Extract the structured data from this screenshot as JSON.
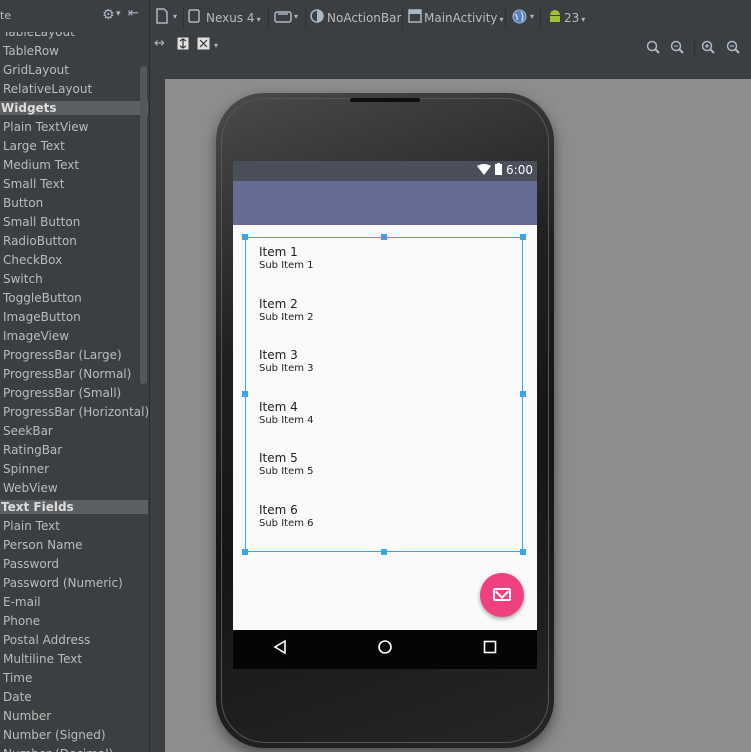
{
  "palette": {
    "header_title": "te",
    "items": [
      {
        "kind": "item",
        "label": "TableLayout"
      },
      {
        "kind": "item",
        "label": "TableRow"
      },
      {
        "kind": "item",
        "label": "GridLayout"
      },
      {
        "kind": "item",
        "label": "RelativeLayout"
      },
      {
        "kind": "category",
        "label": "Widgets"
      },
      {
        "kind": "item",
        "label": "Plain TextView"
      },
      {
        "kind": "item",
        "label": "Large Text"
      },
      {
        "kind": "item",
        "label": "Medium Text"
      },
      {
        "kind": "item",
        "label": "Small Text"
      },
      {
        "kind": "item",
        "label": "Button"
      },
      {
        "kind": "item",
        "label": "Small Button"
      },
      {
        "kind": "item",
        "label": "RadioButton"
      },
      {
        "kind": "item",
        "label": "CheckBox"
      },
      {
        "kind": "item",
        "label": "Switch"
      },
      {
        "kind": "item",
        "label": "ToggleButton"
      },
      {
        "kind": "item",
        "label": "ImageButton"
      },
      {
        "kind": "item",
        "label": "ImageView"
      },
      {
        "kind": "item",
        "label": "ProgressBar (Large)"
      },
      {
        "kind": "item",
        "label": "ProgressBar (Normal)"
      },
      {
        "kind": "item",
        "label": "ProgressBar (Small)"
      },
      {
        "kind": "item",
        "label": "ProgressBar (Horizontal)"
      },
      {
        "kind": "item",
        "label": "SeekBar"
      },
      {
        "kind": "item",
        "label": "RatingBar"
      },
      {
        "kind": "item",
        "label": "Spinner"
      },
      {
        "kind": "item",
        "label": "WebView"
      },
      {
        "kind": "category",
        "label": "Text Fields"
      },
      {
        "kind": "item",
        "label": "Plain Text"
      },
      {
        "kind": "item",
        "label": "Person Name"
      },
      {
        "kind": "item",
        "label": "Password"
      },
      {
        "kind": "item",
        "label": "Password (Numeric)"
      },
      {
        "kind": "item",
        "label": "E-mail"
      },
      {
        "kind": "item",
        "label": "Phone"
      },
      {
        "kind": "item",
        "label": "Postal Address"
      },
      {
        "kind": "item",
        "label": "Multiline Text"
      },
      {
        "kind": "item",
        "label": "Time"
      },
      {
        "kind": "item",
        "label": "Date"
      },
      {
        "kind": "item",
        "label": "Number"
      },
      {
        "kind": "item",
        "label": "Number (Signed)"
      },
      {
        "kind": "item",
        "label": "Number (Decimal)"
      }
    ]
  },
  "toolbar": {
    "device": "Nexus 4",
    "theme": "NoActionBar",
    "activity": "MainActivity",
    "api_level": "23"
  },
  "device": {
    "status_time": "6:00",
    "list_items": [
      {
        "title": "Item 1",
        "subtitle": "Sub Item 1"
      },
      {
        "title": "Item 2",
        "subtitle": "Sub Item 2"
      },
      {
        "title": "Item 3",
        "subtitle": "Sub Item 3"
      },
      {
        "title": "Item 4",
        "subtitle": "Sub Item 4"
      },
      {
        "title": "Item 5",
        "subtitle": "Sub Item 5"
      },
      {
        "title": "Item 6",
        "subtitle": "Sub Item 6"
      }
    ],
    "fab_icon": "email-icon"
  },
  "colors": {
    "ide_background": "#3c3f41",
    "canvas_background": "#8d8d8d",
    "status_bar": "#4b4f5c",
    "app_bar": "#666c93",
    "selection": "#38a5f0",
    "fab": "#f0407f"
  }
}
